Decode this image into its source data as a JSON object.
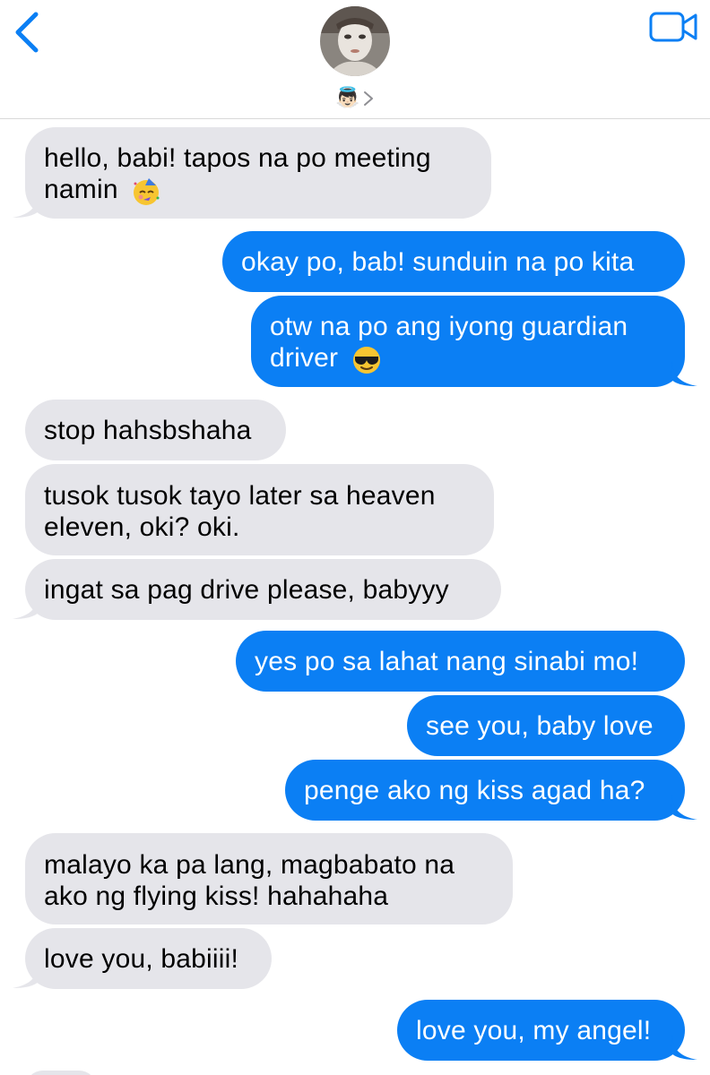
{
  "header": {
    "back_icon": "chevron-left-icon",
    "video_icon": "video-camera-icon",
    "contact_emoji": "👼🏻",
    "accent": "#0b7ff4"
  },
  "messages": [
    {
      "dir": "in",
      "text": "hello, babi! tapos na po meeting namin",
      "emoji": "partying-face-icon"
    },
    {
      "dir": "out",
      "text": "okay po, bab! sunduin na po kita"
    },
    {
      "dir": "out",
      "text": "otw na po ang iyong guardian driver",
      "emoji": "sunglasses-face-icon"
    },
    {
      "dir": "in",
      "text": "stop hahsbshaha"
    },
    {
      "dir": "in",
      "text": "tusok tusok tayo later sa heaven eleven, oki? oki."
    },
    {
      "dir": "in",
      "text": "ingat sa pag drive please, babyyy"
    },
    {
      "dir": "out",
      "text": "yes po sa lahat nang sinabi mo!"
    },
    {
      "dir": "out",
      "text": "see you, baby love"
    },
    {
      "dir": "out",
      "text": "penge ako ng kiss agad ha?"
    },
    {
      "dir": "in",
      "text": "malayo ka pa lang, magbabato na ako ng flying kiss! hahahaha"
    },
    {
      "dir": "in",
      "text": "love you, babiiii!"
    },
    {
      "dir": "out",
      "text": "love you, my angel!"
    }
  ],
  "colors": {
    "incoming_bubble": "#e5e5ea",
    "outgoing_bubble": "#0b7ff4"
  }
}
